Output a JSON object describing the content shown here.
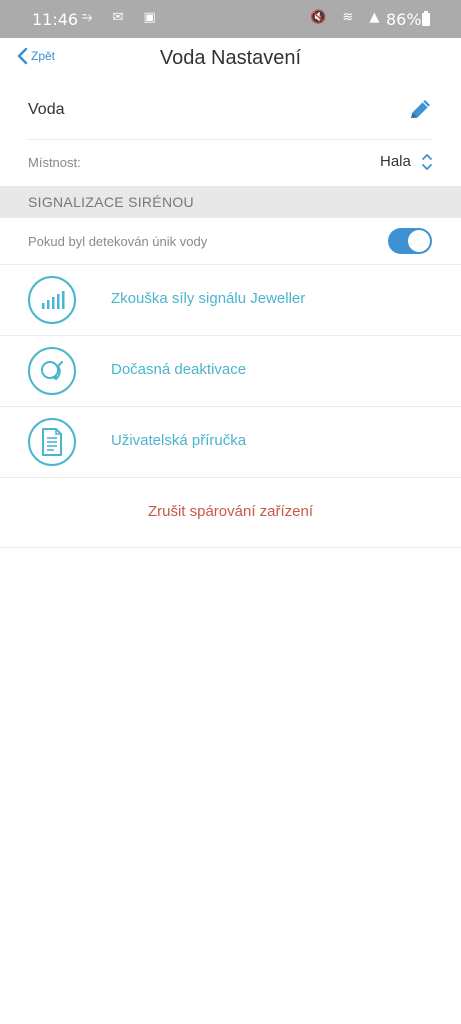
{
  "status_bar": {
    "time": "11:46",
    "left_icons": "⥲ ✉ ▣",
    "right_icons": "🔇 ≋ ▲",
    "battery": "86%"
  },
  "nav": {
    "back_label": "Zpět",
    "title": "Voda Nastavení"
  },
  "device": {
    "name": "Voda"
  },
  "room": {
    "label": "Místnost:",
    "value": "Hala"
  },
  "siren_section": {
    "header": "SIGNALIZACE SIRÉNOU",
    "toggle_label": "Pokud byl detekován únik vody",
    "toggle_on": true
  },
  "menu": {
    "items": [
      {
        "label": "Zkouška síly signálu Jeweller",
        "icon": "signal-strength-icon"
      },
      {
        "label": "Dočasná deaktivace",
        "icon": "deactivate-icon"
      },
      {
        "label": "Uživatelská příručka",
        "icon": "manual-icon"
      }
    ]
  },
  "unpair": {
    "label": "Zrušit spárování zařízení"
  },
  "colors": {
    "accent": "#3d92d4",
    "link": "#49b5cf",
    "danger": "#c9574a"
  }
}
